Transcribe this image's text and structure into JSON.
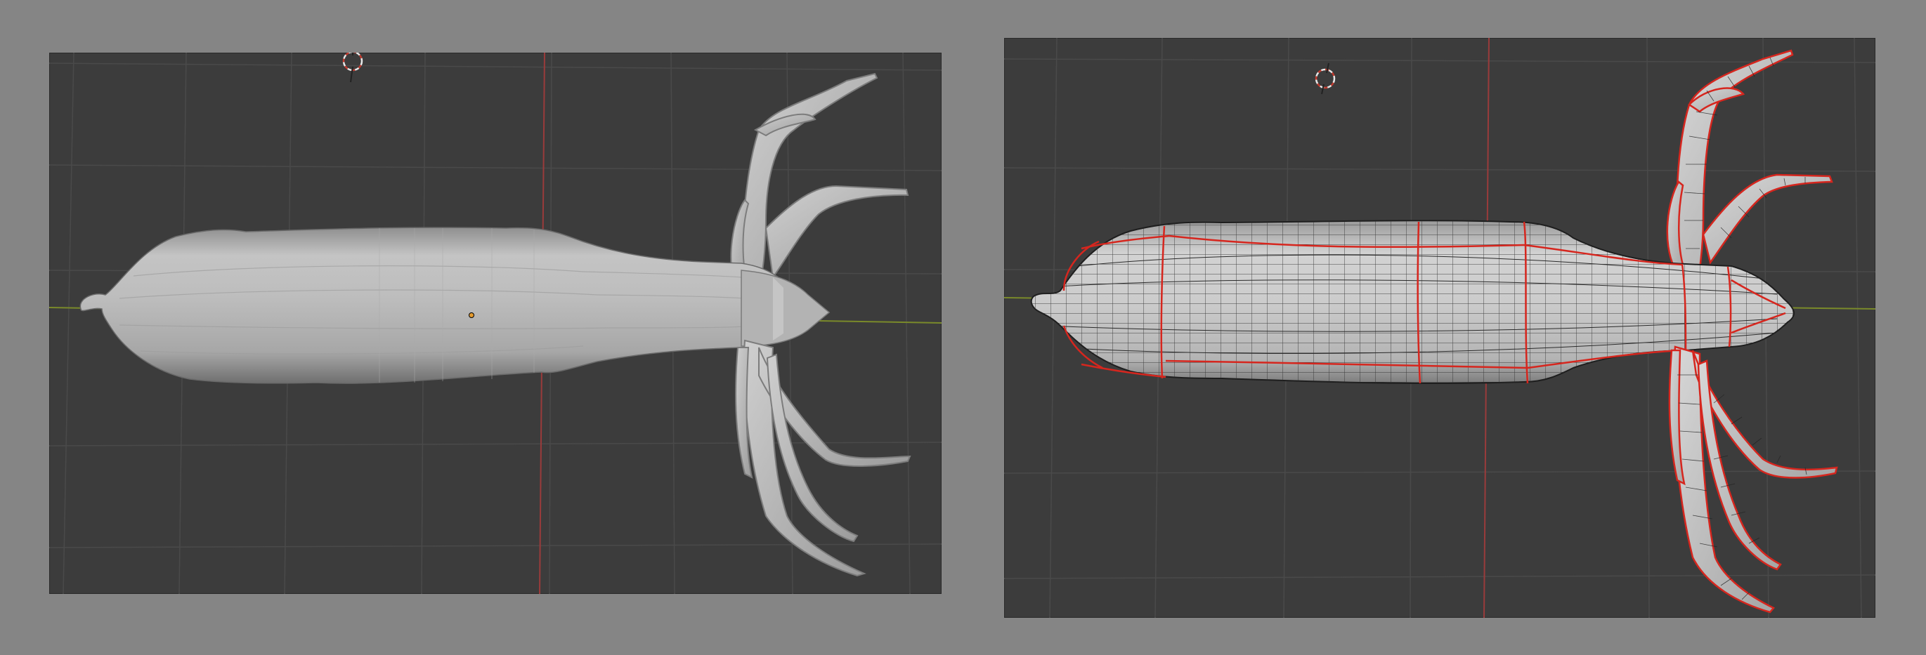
{
  "viewports": [
    {
      "name": "solid-shaded-view",
      "shading": "solid",
      "grid_visible": true,
      "colors": {
        "background": "#3c3c3c",
        "mesh": "#b8b8b8",
        "x_axis": "#9a3b3b",
        "y_axis": "#7a8a2a",
        "origin": "#e39a2e"
      }
    },
    {
      "name": "wireframe-overlay-view",
      "shading": "solid-with-wireframe",
      "grid_visible": true,
      "colors": {
        "background": "#3c3c3c",
        "mesh": "#c9c9c9",
        "wire": "#1e1e1e",
        "seams": "#d6261e",
        "x_axis": "#9a3b3b",
        "y_axis": "#7a8a2a"
      }
    }
  ]
}
